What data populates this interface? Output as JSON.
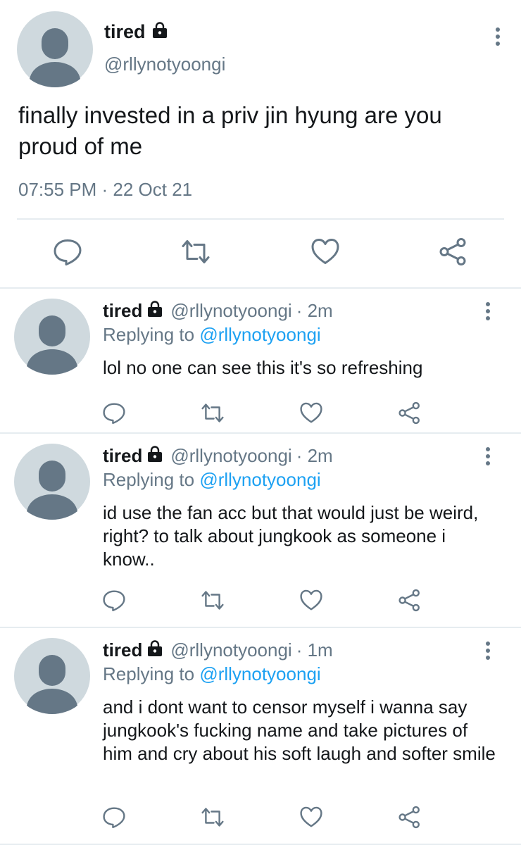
{
  "main_tweet": {
    "display_name": "tired",
    "handle": "@rllynotyoongi",
    "text": "finally invested in a priv jin hyung are you proud of me",
    "timestamp": "07:55 PM · 22 Oct 21",
    "icons": [
      "lock-icon",
      "more-vertical-icon",
      "reply-icon",
      "retweet-icon",
      "like-icon",
      "share-icon"
    ]
  },
  "replies": [
    {
      "display_name": "tired",
      "handle": "@rllynotyoongi",
      "age": "· 2m",
      "replying_prefix": "Replying to",
      "replying_handle": "@rllynotyoongi",
      "text": "lol no one can see this it's so refreshing"
    },
    {
      "display_name": "tired",
      "handle": "@rllynotyoongi",
      "age": "· 2m",
      "replying_prefix": "Replying to",
      "replying_handle": "@rllynotyoongi",
      "text": "id use the fan acc but that would just be weird, right? to talk about jungkook as someone i know.."
    },
    {
      "display_name": "tired",
      "handle": "@rllynotyoongi",
      "age": "· 1m",
      "replying_prefix": "Replying to",
      "replying_handle": "@rllynotyoongi",
      "text": "and i dont want to censor myself i wanna say jungkook's fucking name and take pictures of him and cry about his soft laugh and softer smile"
    }
  ],
  "colors": {
    "text": "#14171a",
    "muted": "#657786",
    "link": "#1da1f2",
    "divider": "#e6ecf0",
    "avatar_bg": "#cfd9de",
    "avatar_figure": "#657786"
  }
}
